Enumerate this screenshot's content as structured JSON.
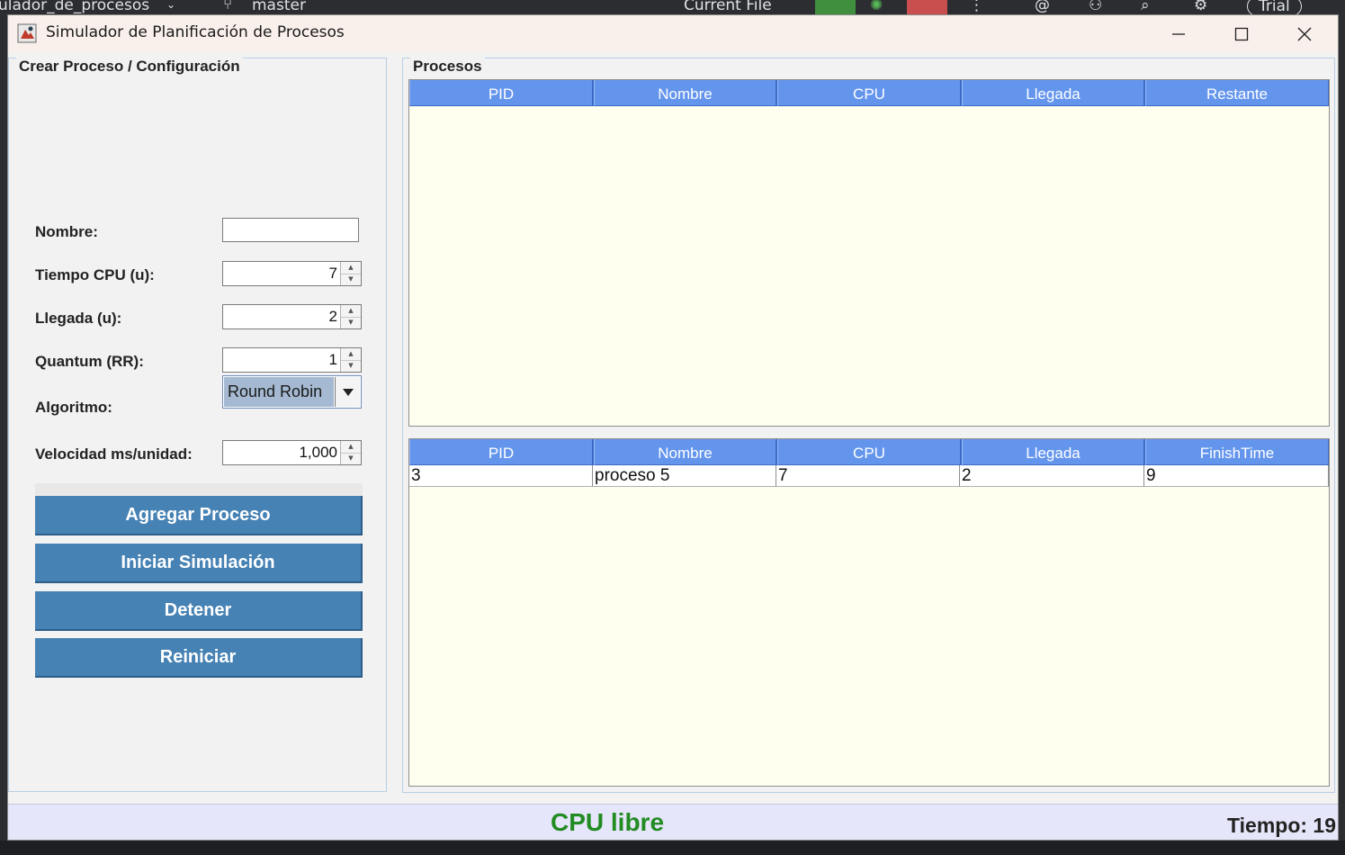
{
  "ide": {
    "project_partial": "ulador_de_procesos",
    "branch": "master",
    "run_config": "Current File",
    "trial": "Trial"
  },
  "window": {
    "title": "Simulador de Planificación de Procesos"
  },
  "left_panel": {
    "legend": "Crear Proceso / Configuración",
    "fields": {
      "nombre_label": "Nombre:",
      "nombre_value": "",
      "cpu_label": "Tiempo CPU (u):",
      "cpu_value": "7",
      "llegada_label": "Llegada (u):",
      "llegada_value": "2",
      "quantum_label": "Quantum (RR):",
      "quantum_value": "1",
      "algoritmo_label": "Algoritmo:",
      "algoritmo_value": "Round Robin",
      "velocidad_label": "Velocidad ms/unidad:",
      "velocidad_value": "1,000"
    },
    "buttons": {
      "agregar": "Agregar Proceso",
      "iniciar": "Iniciar Simulación",
      "detener": "Detener",
      "reiniciar": "Reiniciar"
    }
  },
  "right_panel": {
    "legend": "Procesos",
    "ready_table": {
      "columns": [
        "PID",
        "Nombre",
        "CPU",
        "Llegada",
        "Restante"
      ],
      "rows": []
    },
    "finished_table": {
      "columns": [
        "PID",
        "Nombre",
        "CPU",
        "Llegada",
        "FinishTime"
      ],
      "rows": [
        [
          "3",
          "proceso 5",
          "7",
          "2",
          "9"
        ]
      ]
    }
  },
  "status": {
    "cpu": "CPU libre",
    "time": "Tiempo: 19"
  },
  "colors": {
    "header_blue": "#6495ed",
    "button_blue": "#4682b4",
    "table_bg": "#fffff0",
    "status_bg": "#e6e6fa",
    "cpu_status_green": "#228b22"
  }
}
